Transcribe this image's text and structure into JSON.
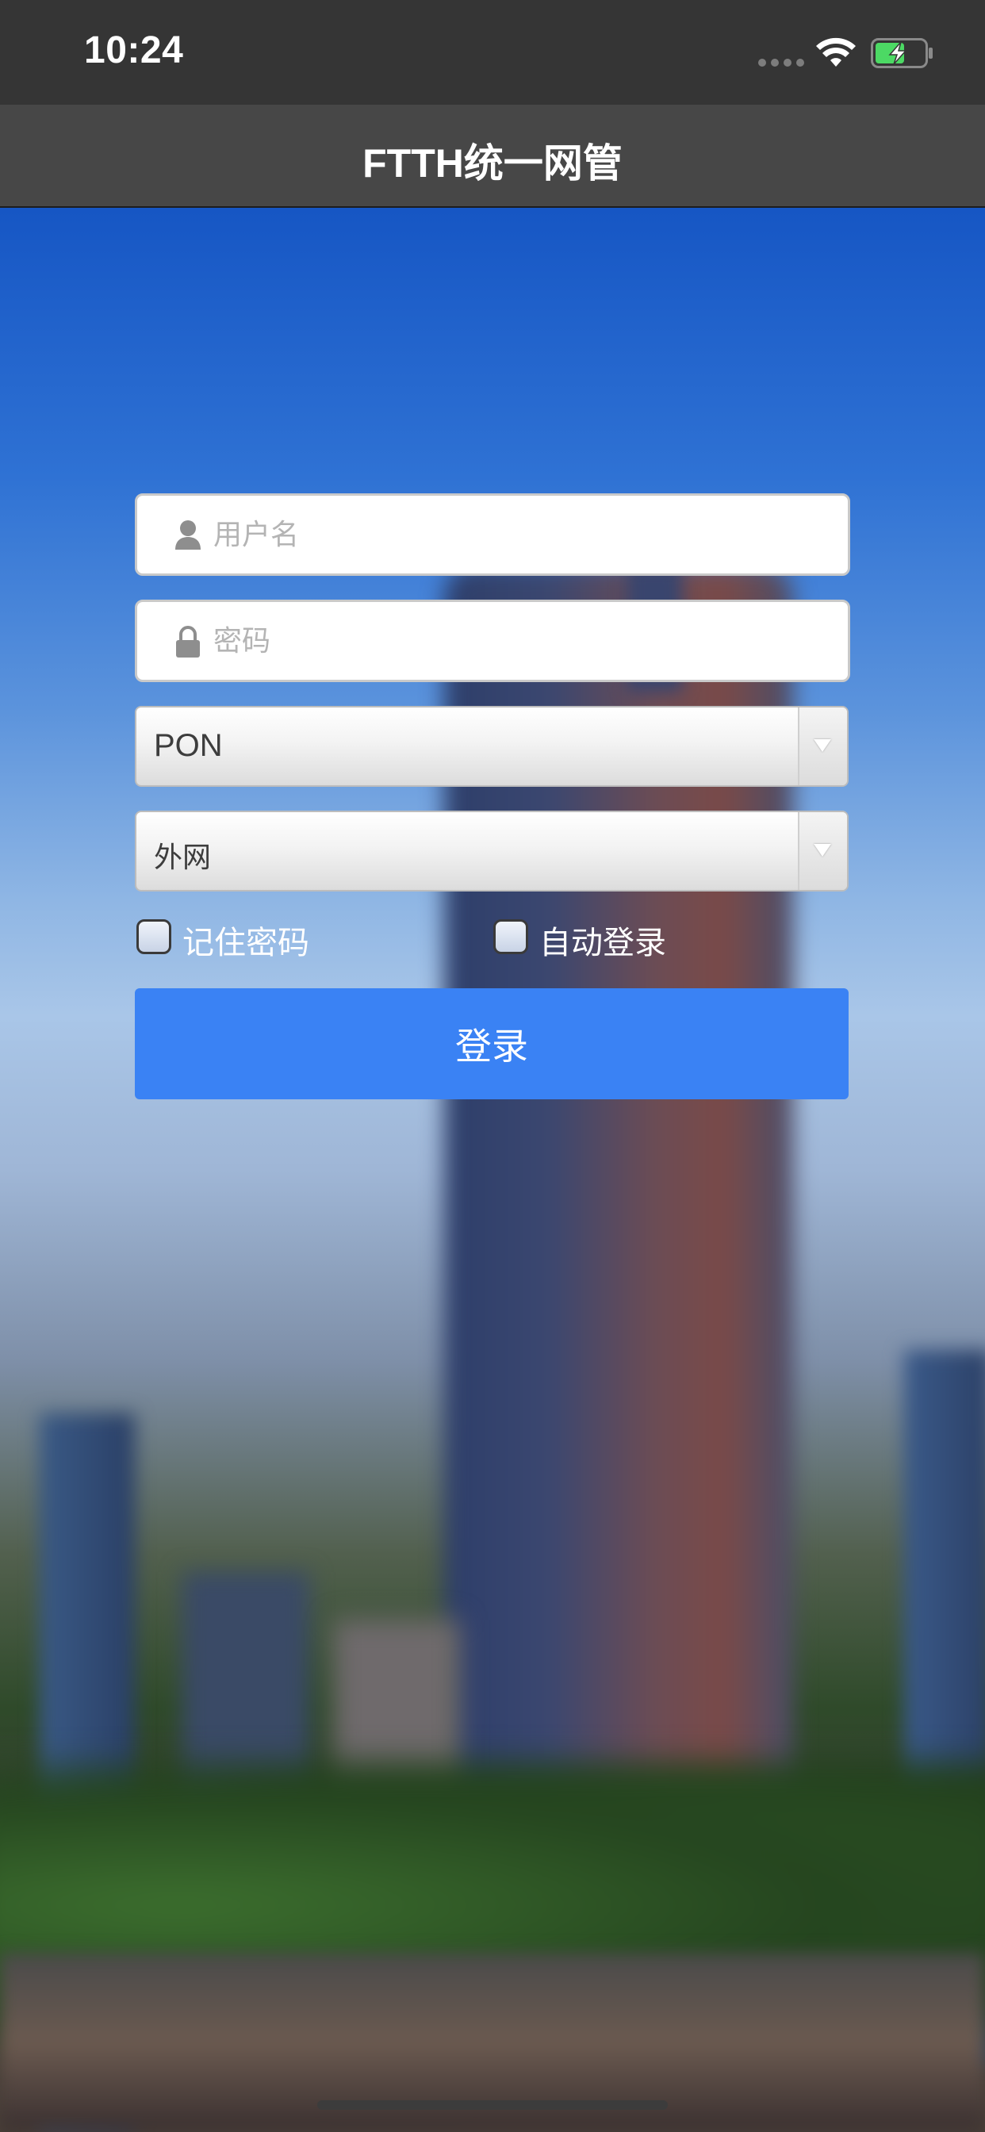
{
  "status_bar": {
    "time": "10:24",
    "icons": [
      "cellular-signal-icon",
      "wifi-icon",
      "battery-charging-icon"
    ]
  },
  "nav": {
    "title": "FTTH统一网管"
  },
  "form": {
    "username": {
      "value": "",
      "placeholder": "用户名",
      "icon": "user-icon"
    },
    "password": {
      "value": "",
      "placeholder": "密码",
      "icon": "lock-icon"
    },
    "network_type": {
      "selected": "PON",
      "icon": "dropdown-arrow-icon"
    },
    "network_zone": {
      "selected": "外网",
      "icon": "dropdown-arrow-icon"
    },
    "remember_password": {
      "label": "记住密码",
      "checked": false
    },
    "auto_login": {
      "label": "自动登录",
      "checked": false
    },
    "login_label": "登录"
  },
  "colors": {
    "status_bar_bg": "#353535",
    "nav_bar_bg": "#474747",
    "login_button": "#3a82f4",
    "battery_fill": "#4cd964"
  }
}
